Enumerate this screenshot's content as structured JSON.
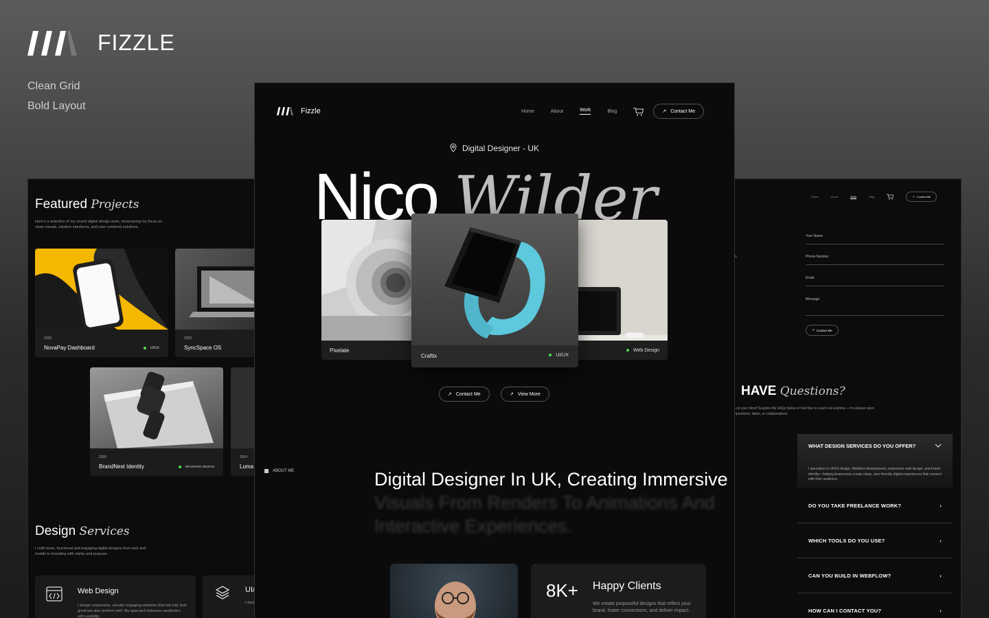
{
  "brand": {
    "name": "FIZZLE",
    "taglines": [
      "Clean Grid",
      "Bold Layout"
    ]
  },
  "left_panel": {
    "featured": {
      "title": "Featured",
      "title_italic": "Projects",
      "description": "Here's a selection of my recent digital design work, showcasing my focus on clean visuals, intuitive interfaces, and user-centered solutions."
    },
    "projects": [
      {
        "year": "2025",
        "name": "NovaPay Dashboard",
        "tag": "UI/UX"
      },
      {
        "year": "2022",
        "name": "SyncSpace OS",
        "tag": ""
      },
      {
        "year": "2020",
        "name": "BrandNest Identity",
        "tag": "BRANDING DESIGN"
      },
      {
        "year": "2024",
        "name": "Luma",
        "tag": ""
      }
    ],
    "services": {
      "title": "Design",
      "title_italic": "Services",
      "description": "I craft clean, functional and engaging digital designs from web and mobile to branding with clarity and purpose."
    },
    "service_cards": [
      {
        "name": "Web Design",
        "desc": "I design responsive, visually engaging websites that not only look great but also perform well. My approach balances aesthetics with usability."
      },
      {
        "name": "UI/",
        "desc": "I desi deliv"
      }
    ]
  },
  "center": {
    "nav": {
      "logo": "Fizzle",
      "links": [
        "Home",
        "About",
        "Work",
        "Blog"
      ],
      "active": "Work",
      "contact": "Contact Me"
    },
    "location": "Digital Designer - UK",
    "hero": {
      "first": "Nico",
      "last": "Wilder"
    },
    "cards": [
      {
        "label": "Pixelate",
        "tag": ""
      },
      {
        "label": "Craftix",
        "tag": "UI/UX"
      },
      {
        "label": "",
        "tag": "Web Design"
      }
    ],
    "buttons": {
      "contact": "Contact Me",
      "view_more": "View More"
    },
    "about": {
      "tag": "ABOUT ME",
      "heading_visible": "Digital Designer In UK, Creating Immersive",
      "heading_faded": "Visuals From Renders To Animations And Interactive Experiences."
    },
    "stat": {
      "value": "8K+",
      "label": "Happy Clients",
      "desc": "We create purposeful designs that reflect your brand, foster connections, and deliver impact."
    }
  },
  "right_panel": {
    "nav": {
      "links": [
        "Home",
        "About",
        "Work",
        "Blog"
      ],
      "contact": "Contact Me"
    },
    "form": {
      "fields": [
        "Your Name",
        "Phone Number",
        "Email",
        "Message"
      ],
      "submit": "Contact Me",
      "side_text": "llo,"
    },
    "faq_title": {
      "bold": "HAVE",
      "italic": "Questions?"
    },
    "faq_desc": "ng on your mind? Explore the FAQs below or feel free to reach out anytime— I'm always open to questions, ideas, or collaborations.",
    "faqs": [
      {
        "q": "WHAT DESIGN SERVICES DO YOU OFFER?",
        "a": "I specialize in UI/UX design, Webflow development, responsive web design, and brand identity—helping businesses create clean, user-friendly digital experiences that connect with their audience.",
        "open": true
      },
      {
        "q": "DO YOU TAKE FREELANCE WORK?"
      },
      {
        "q": "WHICH TOOLS DO YOU USE?"
      },
      {
        "q": "CAN YOU BUILD IN WEBFLOW?"
      },
      {
        "q": "HOW CAN I CONTACT YOU?"
      }
    ]
  },
  "colors": {
    "accent_green": "#4ce04c",
    "watch_band": "#5ec8dc",
    "phone_yellow": "#f5b800"
  }
}
